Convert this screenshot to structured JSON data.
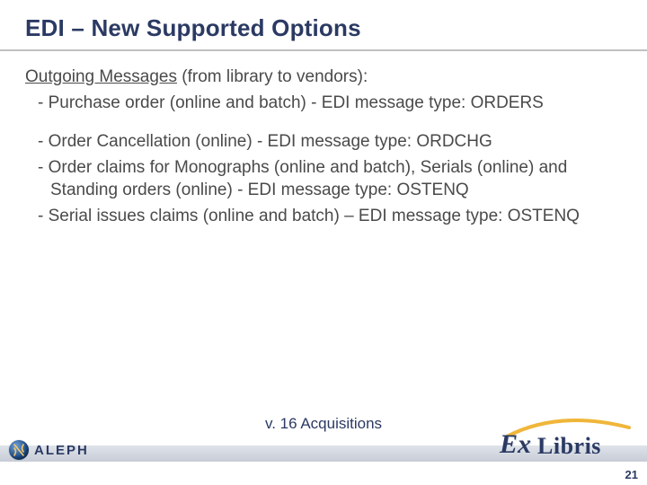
{
  "title": "EDI – New Supported Options",
  "section_label_underlined": "Outgoing Messages",
  "section_label_rest": " (from library to vendors):",
  "items_block1": [
    "- Purchase order (online and batch) - EDI message type: ORDERS"
  ],
  "items_block2": [
    "- Order Cancellation (online) - EDI message type: ORDCHG",
    "- Order claims for Monographs (online and batch), Serials (online) and Standing orders (online) - EDI message type: OSTENQ",
    "- Serial issues claims (online and batch) – EDI message type: OSTENQ"
  ],
  "footer": "v. 16 Acquisitions",
  "page_number": "21",
  "logos": {
    "aleph": "ALEPH",
    "exlibris_ex": "Ex",
    "exlibris_libris": "Libris"
  }
}
